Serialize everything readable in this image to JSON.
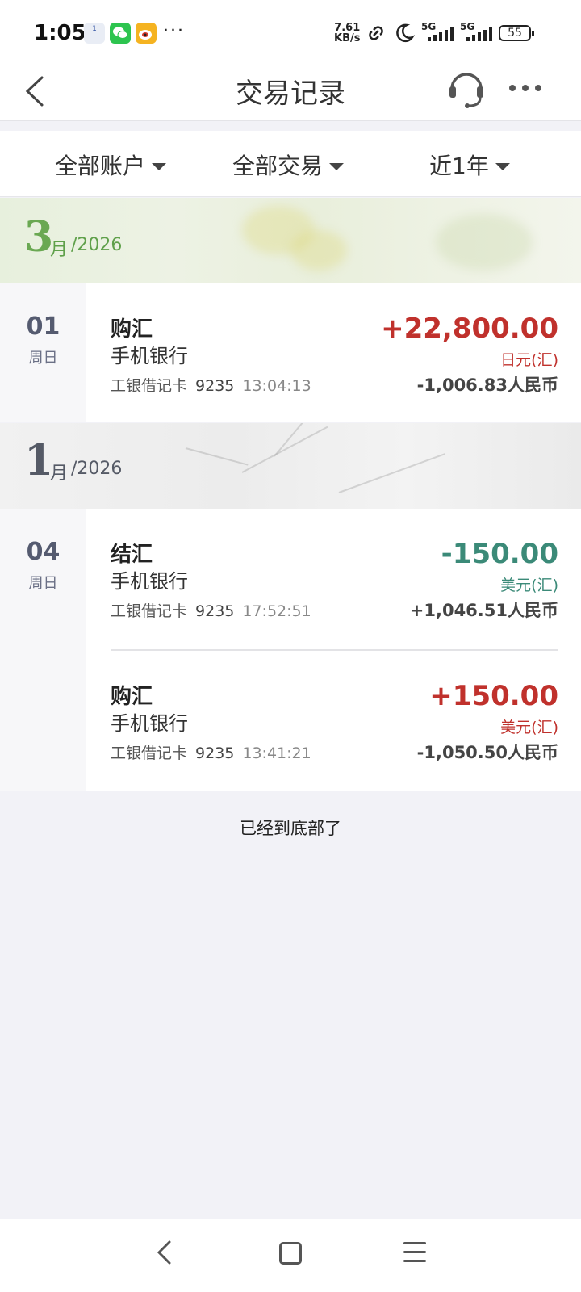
{
  "status_bar": {
    "time": "1:05",
    "calendar_day": "1",
    "net_speed_value": "7.61",
    "net_speed_unit": "KB/s",
    "sim1": "5G",
    "sim2": "5G",
    "battery": "55"
  },
  "header": {
    "title": "交易记录"
  },
  "filters": {
    "account": "全部账户",
    "type": "全部交易",
    "period": "近1年"
  },
  "months": [
    {
      "month": "3",
      "unit": "月",
      "year": "/2026",
      "days": [
        {
          "day": "01",
          "weekday": "周日",
          "transactions": [
            {
              "type": "购汇",
              "channel": "手机银行",
              "card": "工银借记卡",
              "card_no": "9235",
              "time": "13:04:13",
              "amount": "+22,800.00",
              "currency": "日元(汇)",
              "rmb": "-1,006.83人民币",
              "direction": "in"
            }
          ]
        }
      ]
    },
    {
      "month": "1",
      "unit": "月",
      "year": "/2026",
      "days": [
        {
          "day": "04",
          "weekday": "周日",
          "transactions": [
            {
              "type": "结汇",
              "channel": "手机银行",
              "card": "工银借记卡",
              "card_no": "9235",
              "time": "17:52:51",
              "amount": "-150.00",
              "currency": "美元(汇)",
              "rmb": "+1,046.51人民币",
              "direction": "out"
            },
            {
              "type": "购汇",
              "channel": "手机银行",
              "card": "工银借记卡",
              "card_no": "9235",
              "time": "13:41:21",
              "amount": "+150.00",
              "currency": "美元(汇)",
              "rmb": "-1,050.50人民币",
              "direction": "in"
            }
          ]
        }
      ]
    }
  ],
  "footer": {
    "end_note": "已经到底部了"
  },
  "colors": {
    "income_red": "#c0312c",
    "expense_green": "#3b8a78",
    "march_banner_green": "#6aa852",
    "january_banner_gray": "#555a66"
  },
  "icons": [
    "back-icon",
    "headset-icon",
    "more-icon",
    "caret-down-icon",
    "nav-back-icon",
    "nav-home-icon",
    "nav-menu-icon"
  ]
}
